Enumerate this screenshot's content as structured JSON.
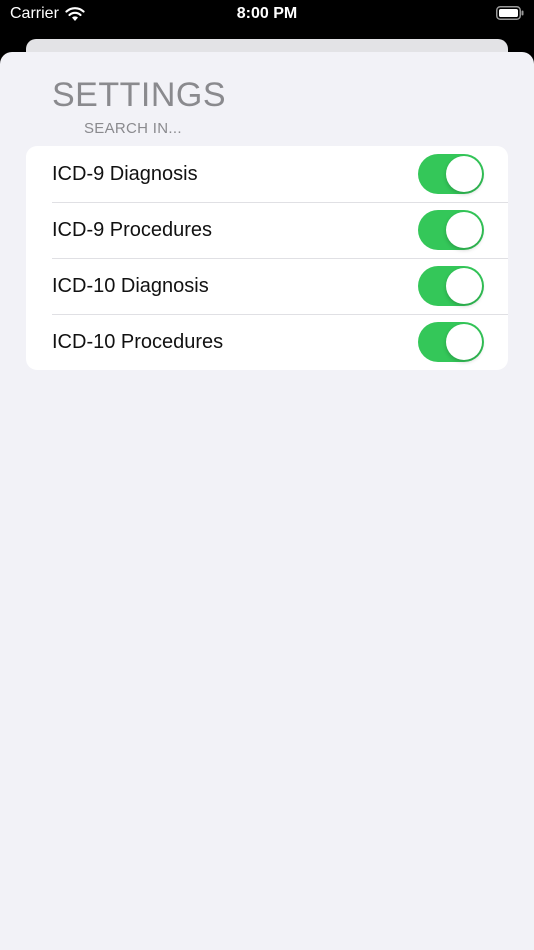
{
  "status_bar": {
    "carrier": "Carrier",
    "time": "8:00 PM",
    "icons": [
      "wifi-icon",
      "battery-icon"
    ]
  },
  "settings": {
    "title": "SETTINGS",
    "section_header": "SEARCH IN...",
    "items": [
      {
        "label": "ICD-9 Diagnosis",
        "enabled": true
      },
      {
        "label": "ICD-9 Procedures",
        "enabled": true
      },
      {
        "label": "ICD-10 Diagnosis",
        "enabled": true
      },
      {
        "label": "ICD-10 Procedures",
        "enabled": true
      }
    ]
  },
  "colors": {
    "toggle_on": "#34c759",
    "background": "#f2f2f7",
    "secondary_text": "#8a8a8e"
  }
}
